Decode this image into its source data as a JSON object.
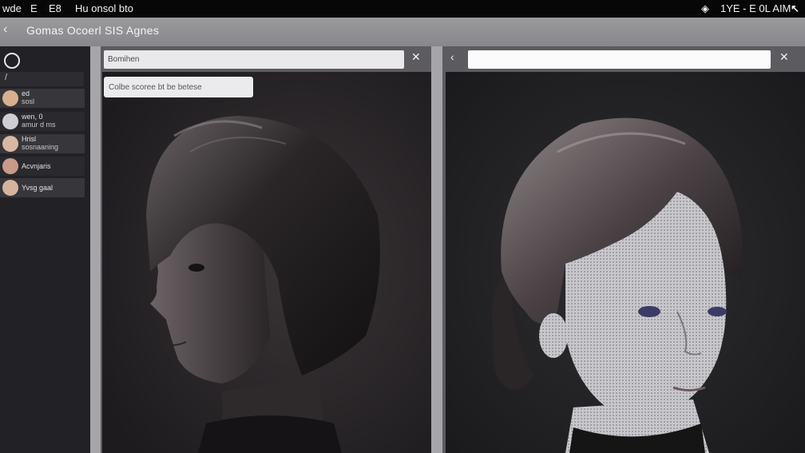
{
  "status_bar": {
    "left_items": [
      "wde",
      "E",
      "E8",
      "Hu onsol bto"
    ],
    "right_text": "1YE - E 0L AIM",
    "right_arrow": "↖"
  },
  "window": {
    "back_icon": "chevron-left-icon",
    "title": "Gomas Ocoerl  SIS  Agnes"
  },
  "sidebar": {
    "header": "/",
    "items": [
      {
        "line1": "ed",
        "line2": "sosl",
        "avatar_color": "#d9b08f"
      },
      {
        "line1": "wen, 0",
        "line2": "amur d ms",
        "avatar_color": "#cfcfd3"
      },
      {
        "line1": "Hrisl",
        "line2": "sosnaaning",
        "avatar_color": "#d8b8a4"
      },
      {
        "line1": "Acvnjaris",
        "line2": "",
        "avatar_color": "#c99a88"
      },
      {
        "line1": "Yvsg gaal",
        "line2": "",
        "avatar_color": "#d6b39d"
      }
    ]
  },
  "left_panel": {
    "search_value": "Bomihen",
    "close_icon": "close-icon",
    "tooltip": "Colbe scoree bt be betese",
    "image_desc": "3D render of woman with short bob haircut, profile view"
  },
  "right_panel": {
    "back_icon": "chevron-left-icon",
    "input_value": "",
    "close_icon": "close-icon",
    "image_desc": "3D wireframe-textured woman with bangs and updo hair"
  },
  "colors": {
    "topbar": "#070707",
    "sidebar": "#222226",
    "panel": "#5b5b60",
    "canvas": "#2b2a2e"
  }
}
